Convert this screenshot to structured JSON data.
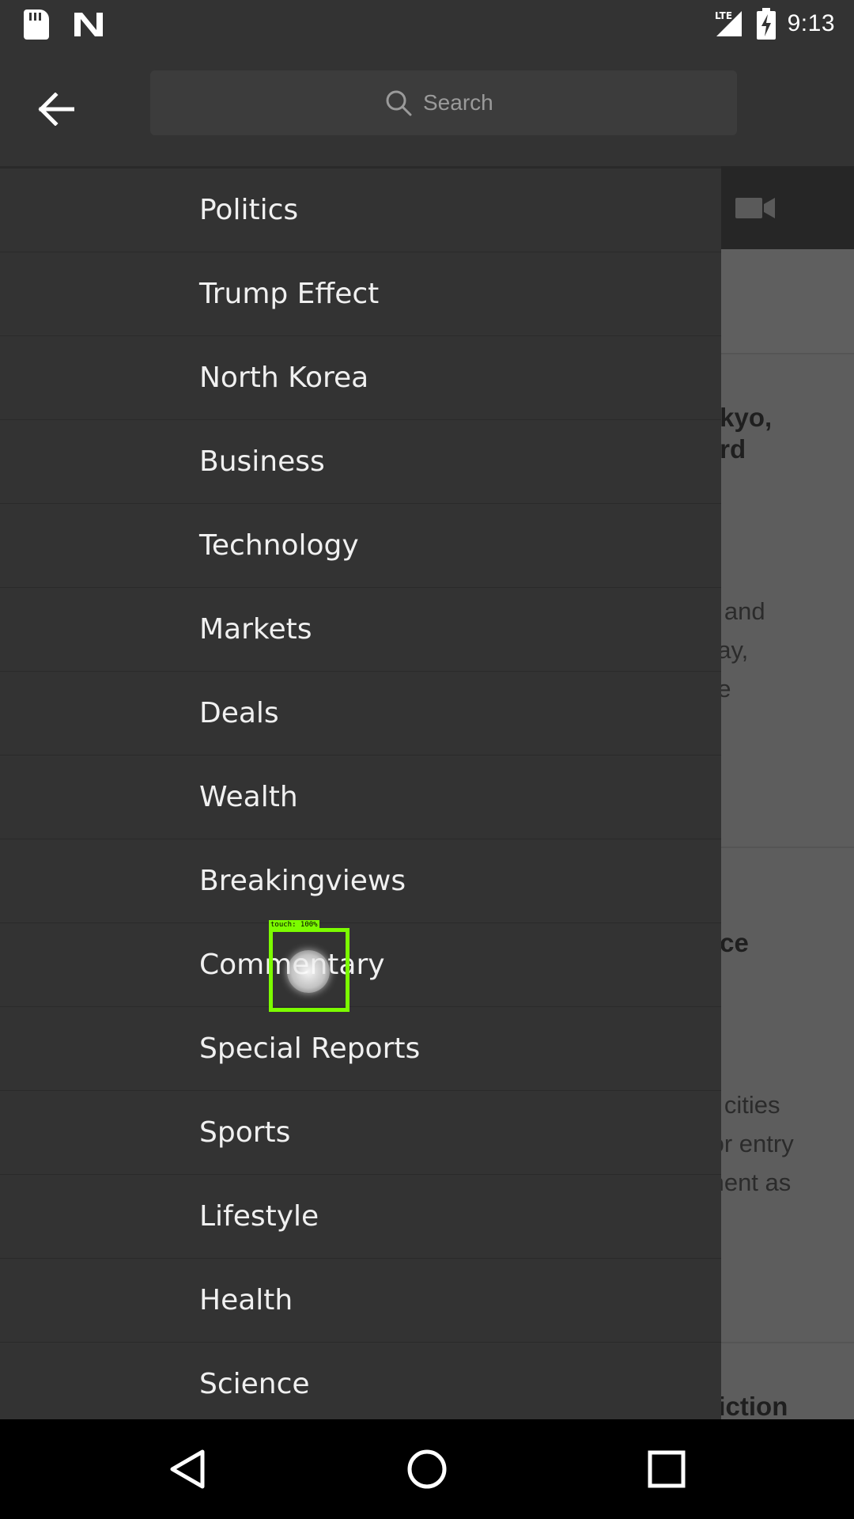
{
  "status_bar": {
    "time": "9:13",
    "network": "LTE",
    "icons": [
      "sd-card-icon",
      "n-notification-icon",
      "lte-signal-icon",
      "battery-charging-icon"
    ]
  },
  "app_bar": {
    "back_icon": "arrow-left-icon",
    "search": {
      "placeholder": "Search",
      "value": "",
      "icon": "search-icon"
    }
  },
  "drawer": {
    "items": [
      {
        "label": "Politics"
      },
      {
        "label": "Trump Effect"
      },
      {
        "label": "North Korea"
      },
      {
        "label": "Business"
      },
      {
        "label": "Technology"
      },
      {
        "label": "Markets"
      },
      {
        "label": "Deals"
      },
      {
        "label": "Wealth"
      },
      {
        "label": "Breakingviews"
      },
      {
        "label": "Commentary"
      },
      {
        "label": "Special Reports"
      },
      {
        "label": "Sports"
      },
      {
        "label": "Lifestyle"
      },
      {
        "label": "Health"
      },
      {
        "label": "Science"
      }
    ]
  },
  "background": {
    "video_icon": "video-camera-icon",
    "card1": {
      "headline": [
        "okyo,",
        "ord"
      ],
      "body": [
        "d and",
        "day,",
        "he"
      ]
    },
    "card2": {
      "headline": [
        "nce"
      ],
      "body": [
        "n cities",
        "for entry",
        "ment as"
      ]
    },
    "card3": {
      "headline": [
        "viction"
      ]
    }
  },
  "touch_indicator": {
    "label": "touch: 100%"
  },
  "nav_bar": {
    "back_icon": "triangle-back-icon",
    "home_icon": "circle-home-icon",
    "recents_icon": "square-recents-icon"
  },
  "colors": {
    "drawer_bg": "#333333",
    "divider": "#2a2a2a",
    "touch_highlight": "#7cfc00",
    "nav_bg": "#000000"
  }
}
